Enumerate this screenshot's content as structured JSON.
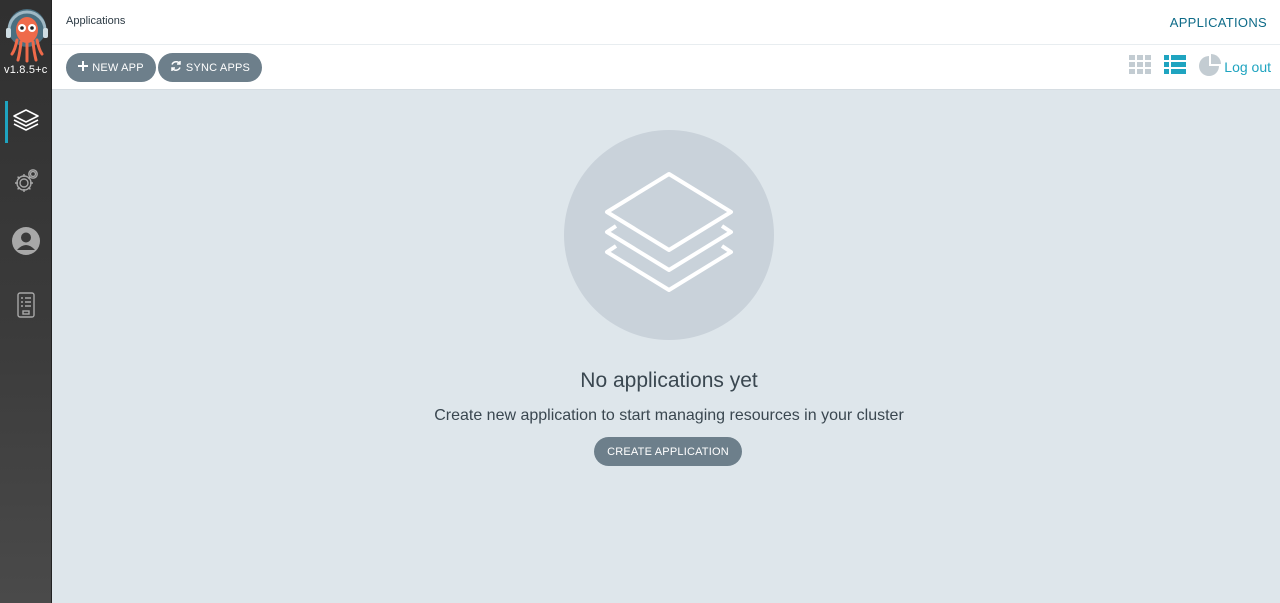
{
  "app": {
    "version": "v1.8.5+c"
  },
  "sidebar": {
    "items": [
      {
        "name": "applications",
        "icon": "layers-icon",
        "active": true
      },
      {
        "name": "settings",
        "icon": "gears-icon",
        "active": false
      },
      {
        "name": "user-info",
        "icon": "user-circle-icon",
        "active": false
      },
      {
        "name": "docs",
        "icon": "docs-icon",
        "active": false
      }
    ]
  },
  "header": {
    "page_title": "Applications",
    "tab_label": "APPLICATIONS"
  },
  "toolbar": {
    "new_app_label": "NEW APP",
    "sync_apps_label": "SYNC APPS",
    "view_modes": [
      {
        "name": "tiles",
        "icon": "grid-icon",
        "active": false
      },
      {
        "name": "list",
        "icon": "list-icon",
        "active": true
      },
      {
        "name": "summary",
        "icon": "pie-chart-icon",
        "active": false
      }
    ],
    "logout_label": "Log out"
  },
  "empty_state": {
    "title": "No applications yet",
    "subtitle": "Create new application to start managing resources in your cluster",
    "create_label": "CREATE APPLICATION"
  },
  "colors": {
    "accent": "#1fa4c0",
    "tab_text": "#0e6b88",
    "button_bg": "#6d7f8b",
    "main_bg": "#dee6eb",
    "sidebar_bg": "#303030"
  }
}
